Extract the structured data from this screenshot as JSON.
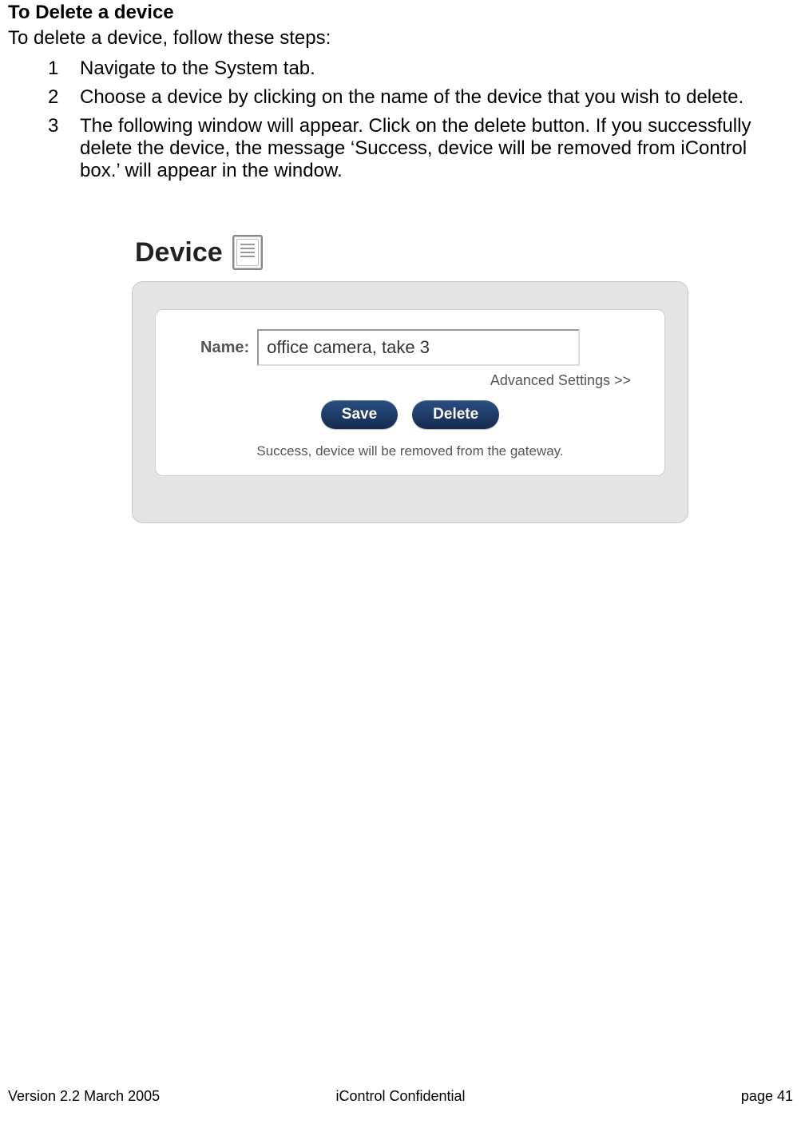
{
  "section_title": "To Delete a device",
  "intro": "To delete a device, follow these steps:",
  "steps": [
    "Navigate to the System tab.",
    "Choose a device by clicking on the name of the device that you wish to delete.",
    "The following window will appear.  Click on the delete button.  If you successfully delete the device, the message ‘Success, device will be removed from iControl box.’ will appear in the window."
  ],
  "dialog": {
    "title": "Device",
    "name_label": "Name:",
    "name_value": "office camera, take 3",
    "advanced_link": "Advanced Settings >>",
    "save_label": "Save",
    "delete_label": "Delete",
    "success_message": "Success, device will be removed from the gateway."
  },
  "footer": {
    "left": "Version 2.2 March 2005",
    "center": "iControl     Confidential",
    "right": "page 41"
  }
}
